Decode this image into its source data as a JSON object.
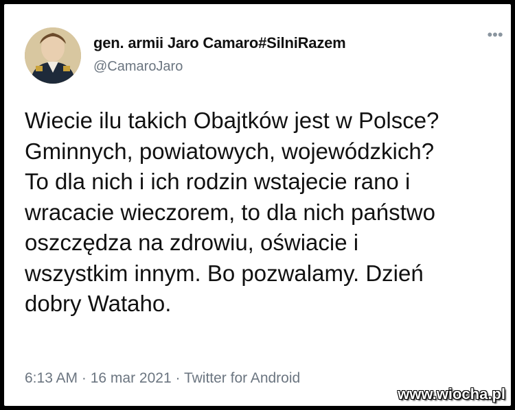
{
  "tweet": {
    "display_name": "gen. armii Jaro Camaro#SilniRazem",
    "handle": "@CamaroJaro",
    "more_icon": "more-horizontal-icon",
    "text": "Wiecie ilu takich Obajtków jest w Polsce?\nGminnych, powiatowych, wojewódzkich?\nTo dla nich i ich rodzin wstajecie rano i\nwracacie wieczorem, to dla nich państwo\noszczędza na zdrowiu, oświacie i\nwszystkim innym. Bo pozwalamy. Dzień\ndobry Wataho.",
    "time": "6:13 AM",
    "date": "16 mar 2021",
    "source": "Twitter for Android"
  },
  "watermark": "www.wiocha.pl",
  "colors": {
    "text": "#111111",
    "secondary": "#6b7580",
    "background": "#ffffff",
    "frame": "#000000"
  }
}
